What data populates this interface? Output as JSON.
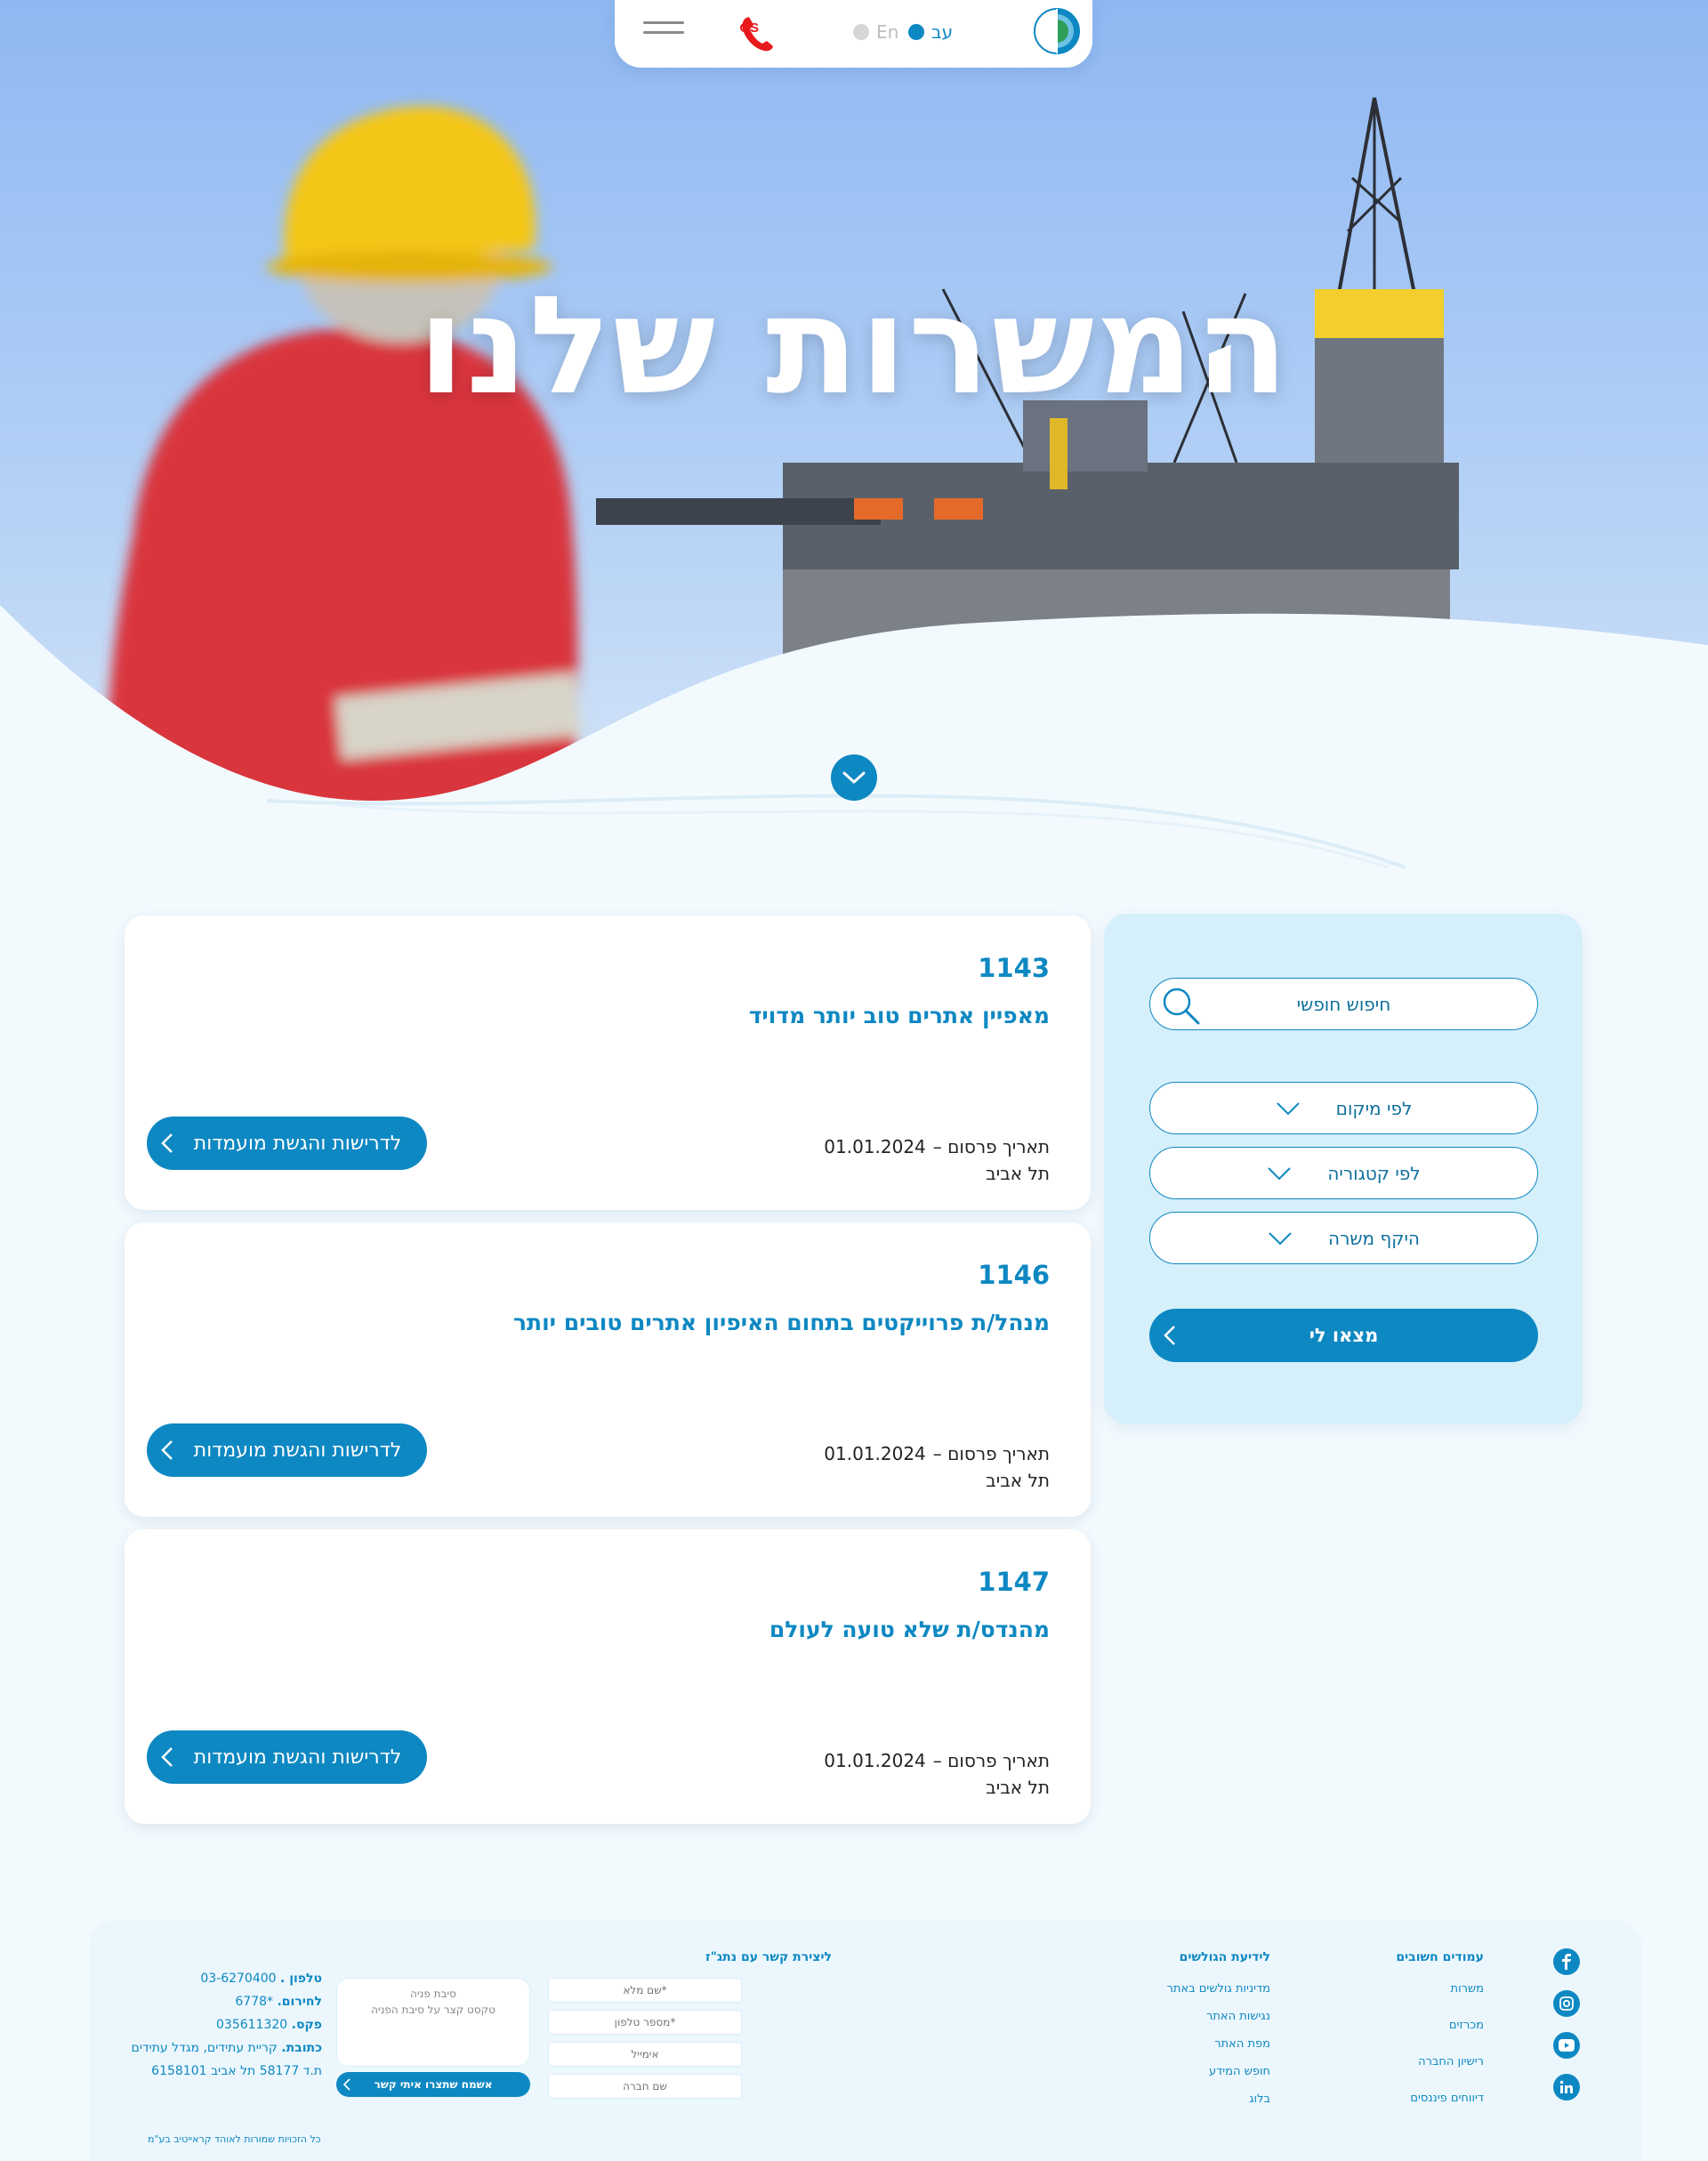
{
  "header": {
    "lang_he": "עב",
    "lang_en": "En",
    "sos_label": "SOS",
    "colors": {
      "accent": "#0e88c2",
      "sos": "#e8191d"
    }
  },
  "hero": {
    "title": "המשרות שלנו"
  },
  "filters": {
    "search_placeholder": "חיפוש חופשי",
    "by_location": "לפי מיקום",
    "by_category": "לפי קטגוריה",
    "job_scope": "היקף משרה",
    "find_button": "מצאו לי"
  },
  "jobs": [
    {
      "id": "1143",
      "title": "מאפיין אתרים טוב יותר מדויד",
      "date_label": "תאריך פרסום –",
      "date": "01.01.2024",
      "city": "תל אביב",
      "apply": "לדרישות והגשת מועמדות"
    },
    {
      "id": "1146",
      "title": "מנהל/ת פרוייקטים בתחום האיפיון אתרים טובים יותר",
      "date_label": "תאריך פרסום –",
      "date": "01.01.2024",
      "city": "תל אביב",
      "apply": "לדרישות והגשת מועמדות"
    },
    {
      "id": "1147",
      "title": "מהנדס/ת שלא טועה לעולם",
      "date_label": "תאריך פרסום –",
      "date": "01.01.2024",
      "city": "תל אביב",
      "apply": "לדרישות והגשת מועמדות"
    }
  ],
  "footer": {
    "important": {
      "title": "עמודים חשובים",
      "links": [
        "משרות",
        "מכרזים",
        "רישיון החברה",
        "דיווחים פיננסים"
      ]
    },
    "surfers": {
      "title": "לידיעת הגולשים",
      "links": [
        "מדיניות גולשים באתר",
        "נגישות האתר",
        "מפת האתר",
        "חופש המידע",
        "בלוג"
      ]
    },
    "contact": {
      "title": "ליצירת קשר עם נתג\"ז",
      "full_name": "*שם מלא",
      "phone": "*מספר טלפון",
      "email": "אימייל",
      "company": "שם חברה",
      "reason_title": "סיבת פניה",
      "reason_text": "טקסט קצר על סיבת הפניה",
      "submit": "אשמח שתצרו איתי קשר"
    },
    "info": {
      "phone_label": "טלפון .",
      "phone": "03-6270400",
      "emergency_label": "לחירום.",
      "emergency": "*6778",
      "fax_label": "פקס.",
      "fax": "035611320",
      "address_label": "כתובת.",
      "address": "קריית עתידים, מגדל עתידים",
      "pobox": "ת.ד 58177 תל אביב 6158101"
    },
    "copyright": "כל הזכויות שמורות לאוהד קראייטיב בע\"מ",
    "social_icons": [
      "facebook-icon",
      "instagram-icon",
      "youtube-icon",
      "linkedin-icon"
    ]
  }
}
